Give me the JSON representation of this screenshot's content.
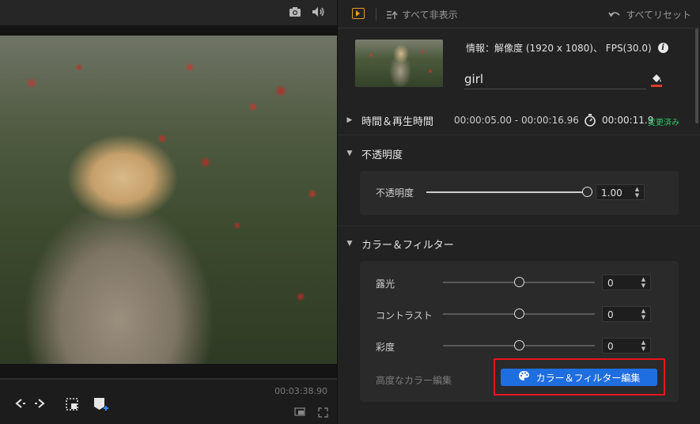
{
  "preview": {
    "timecode": "00:03:38.90"
  },
  "icons": {
    "snapshot": "camera-icon",
    "volume": "speaker-icon",
    "prev_frame": "prev-frame-icon",
    "next_frame": "next-frame-icon",
    "crop": "crop-icon",
    "add_marker": "add-marker-icon",
    "pip": "pip-icon",
    "fullscreen": "fullscreen-icon"
  },
  "properties": {
    "hide_all_label": "すべて非表示",
    "reset_all_label": "すべてリセット",
    "info": "情報：解像度 (1920 x 1080)、 FPS(30.0)",
    "clip_name": "girl",
    "time_section": {
      "title": "時間＆再生時間",
      "duration": "00:00:05.00 - 00:00:16.96",
      "speed_duration": "00:00:11.9",
      "changed_badge": "変更済み"
    },
    "opacity_section": {
      "title": "不透明度",
      "label": "不透明度",
      "value": "1.00",
      "level": 1.0
    },
    "color_section": {
      "title": "カラー＆フィルター",
      "rows": [
        {
          "label": "露光",
          "value": "0",
          "level": 0.5
        },
        {
          "label": "コントラスト",
          "value": "0",
          "level": 0.5
        },
        {
          "label": "彩度",
          "value": "0",
          "level": 0.5
        }
      ],
      "advanced_label": "高度なカラー編集",
      "edit_button_label": "カラー＆フィルター編集"
    }
  },
  "colors": {
    "accent_blue": "#1f6ee0",
    "highlight_red": "#e8141c",
    "changed_green": "#35c46a",
    "panel_icon_orange": "#e0a020"
  }
}
